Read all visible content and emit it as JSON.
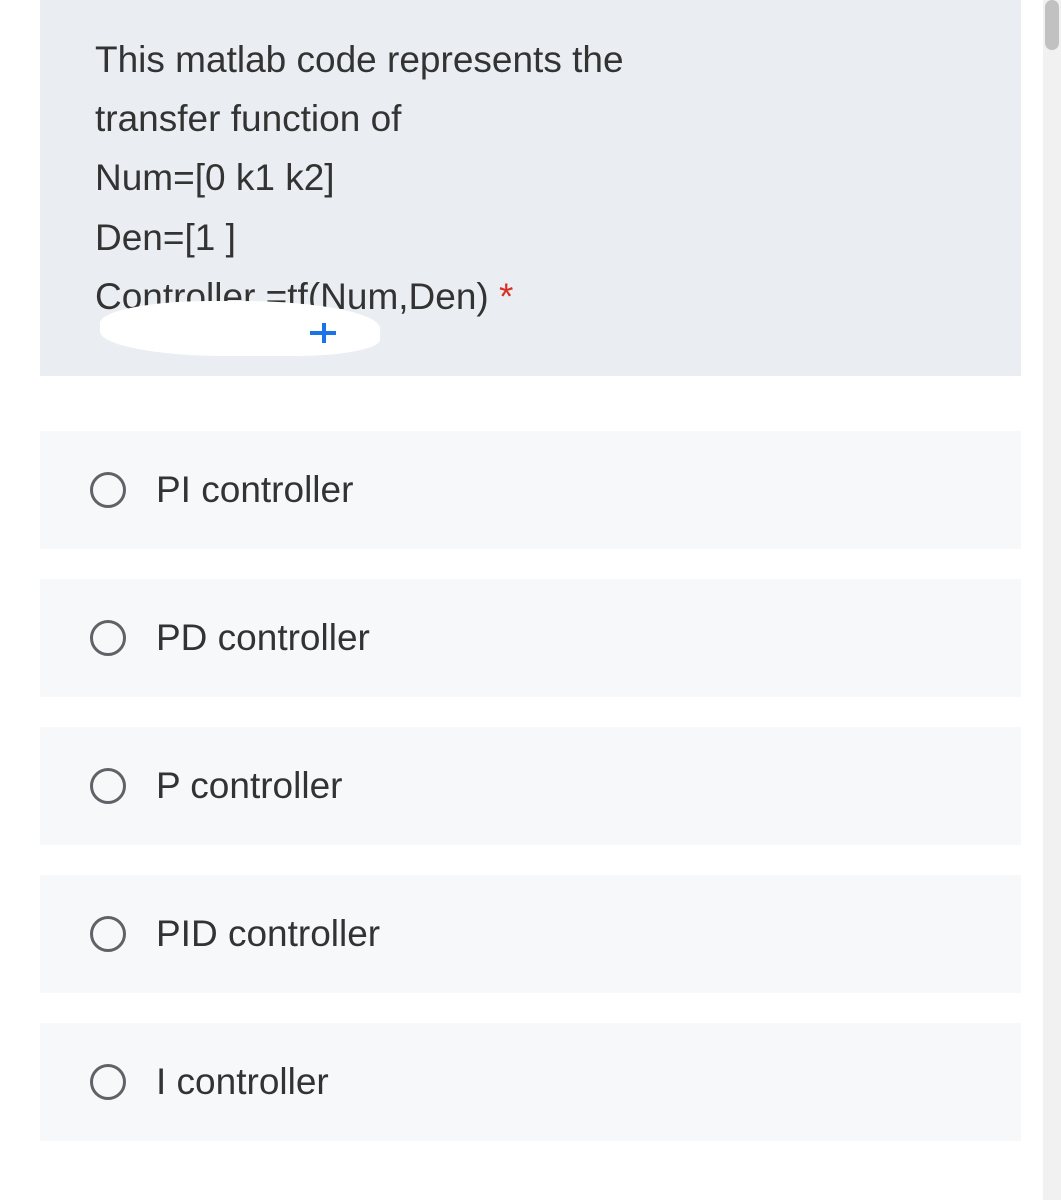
{
  "question": {
    "line1": "This matlab code represents the",
    "line2": "transfer function of",
    "line3": "Num=[0 k1 k2]",
    "line4": "Den=[1 ]",
    "line5": "Controller =tf(Num,Den)",
    "required_mark": "*"
  },
  "options": [
    {
      "label": "PI controller"
    },
    {
      "label": "PD controller"
    },
    {
      "label": "P controller"
    },
    {
      "label": "PID controller"
    },
    {
      "label": "I controller"
    }
  ]
}
